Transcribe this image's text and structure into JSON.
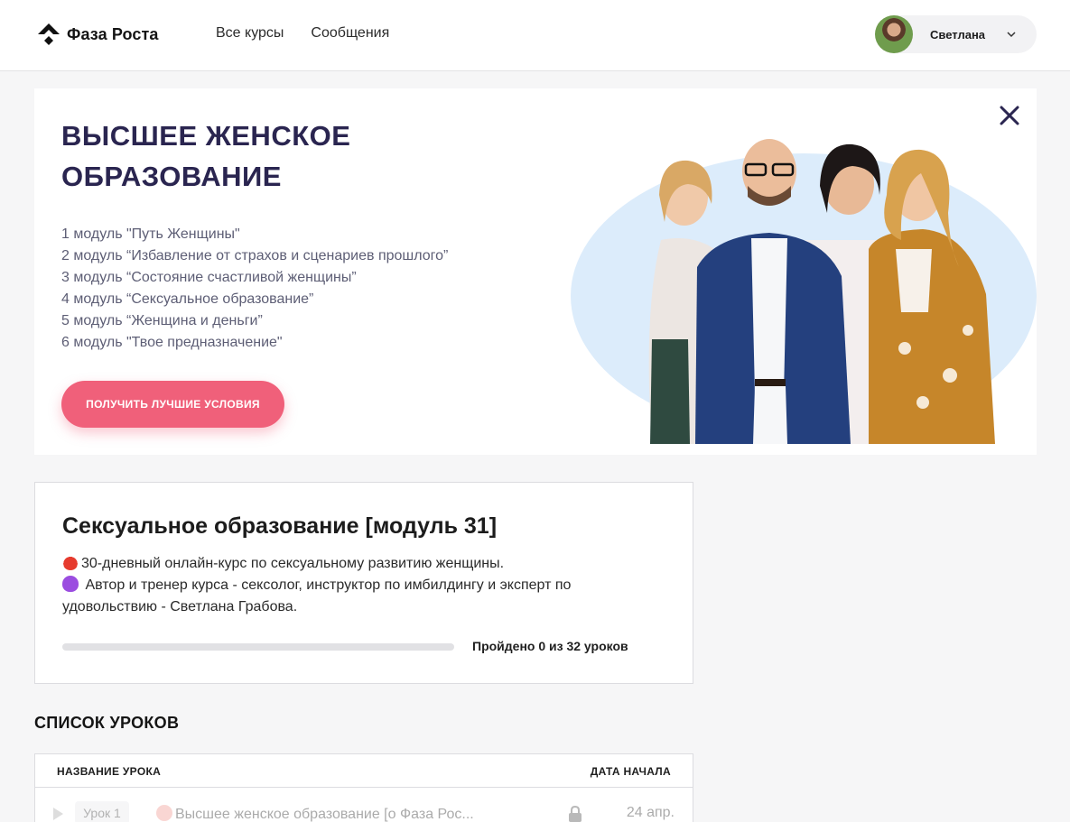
{
  "header": {
    "logo_text": "Фаза Роста",
    "nav": [
      "Все курсы",
      "Сообщения"
    ],
    "user_name": "Светлана"
  },
  "banner": {
    "title": "ВЫСШЕЕ ЖЕНСКОЕ ОБРАЗОВАНИЕ",
    "modules": [
      "1 модуль \"Путь Женщины\"",
      "2 модуль “Избавление от страхов и сценариев прошлого”",
      "3 модуль “Состояние счастливой женщины”",
      "4 модуль “Сексуальное образование”",
      "5 модуль “Женщина и деньги”",
      "6 модуль \"Твое предназначение\""
    ],
    "cta_label": "ПОЛУЧИТЬ ЛУЧШИЕ УСЛОВИЯ",
    "accent_color": "#f0607a",
    "title_color": "#2a2550"
  },
  "course": {
    "title": "Сексуальное образование [модуль 31]",
    "desc_line1": "30-дневный онлайн-курс по сексуальному развитию женщины.",
    "desc_line2": "Автор и тренер курса - сексолог, инструктор по имбилдингу и эксперт по удовольствию - Светлана Грабова.",
    "progress_text": "Пройдено 0 из 32 уроков",
    "progress_fraction": 0
  },
  "lessons": {
    "section_title": "СПИСОК УРОКОВ",
    "col_name": "НАЗВАНИЕ УРОКА",
    "col_date": "ДАТА НАЧАЛА",
    "rows": [
      {
        "num": "Урок 1",
        "name": "Высшее женское образование [о Фаза Рос...",
        "date": "24 апр.",
        "locked": true
      }
    ]
  }
}
